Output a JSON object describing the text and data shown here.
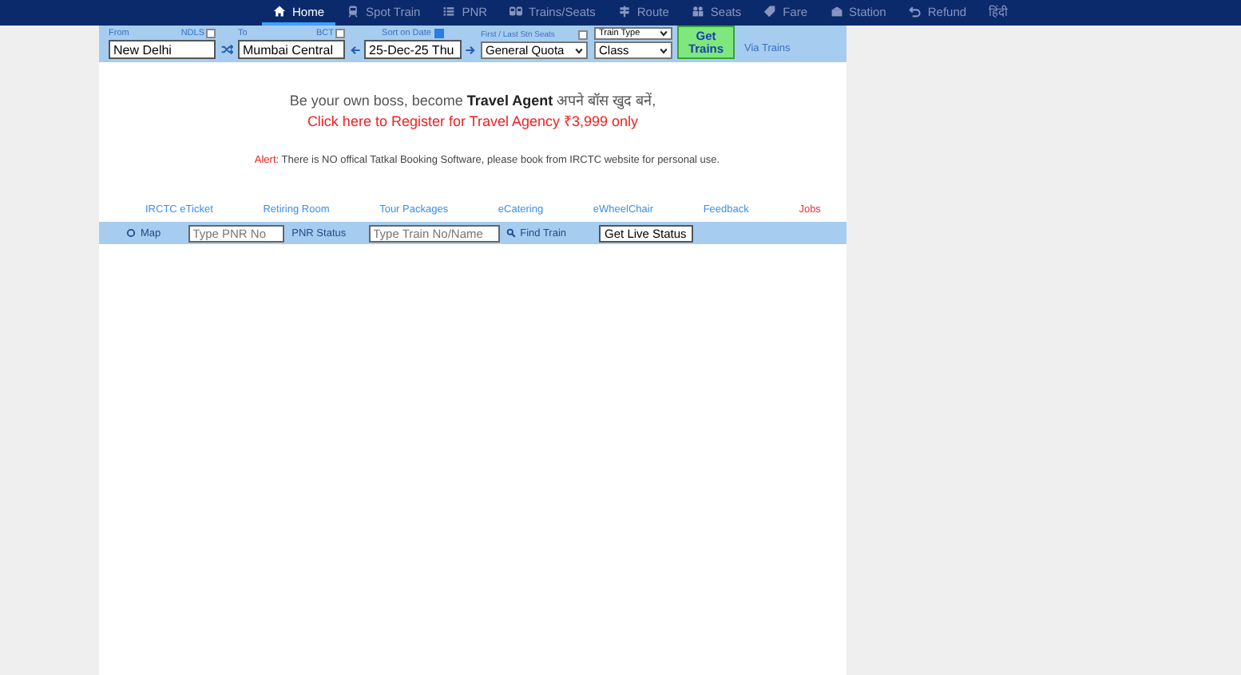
{
  "nav": [
    {
      "label": "Home",
      "selected": true
    },
    {
      "label": "Spot Train",
      "selected": false
    },
    {
      "label": "PNR",
      "selected": false
    },
    {
      "label": "Trains/Seats",
      "selected": false
    },
    {
      "label": "Route",
      "selected": false
    },
    {
      "label": "Seats",
      "selected": false
    },
    {
      "label": "Fare",
      "selected": false
    },
    {
      "label": "Station",
      "selected": false
    },
    {
      "label": "Refund",
      "selected": false
    },
    {
      "label": "हिंदी",
      "selected": false
    }
  ],
  "search": {
    "from": {
      "label": "From",
      "code": "NDLS",
      "checked": false,
      "value": "New Delhi"
    },
    "to": {
      "label": "To",
      "code": "BCT",
      "checked": false,
      "value": "Mumbai Central"
    },
    "sort_on_date": {
      "label": "Sort on Date",
      "checked": true
    },
    "date": "25-Dec-25 Thu",
    "first_last": {
      "label": "First / Last Stn Seats",
      "checked": false
    },
    "quota": "General Quota",
    "train_type": "Train Type",
    "class": "Class",
    "submit": "Get Trains",
    "via": "Via Trains"
  },
  "promo": {
    "line": "Be your own boss, become **Travel Agent** अपने बॉस खुद बनें,",
    "link": "Click here to Register for Travel Agency ₹3,999 only"
  },
  "alert": {
    "label": "Alert",
    "text": ": There is NO offical Tatkal Booking Software, please book from IRCTC website for personal use."
  },
  "links": [
    {
      "label": "IRCTC eTicket",
      "color": "#3b8ee8"
    },
    {
      "label": "Retiring Room",
      "color": "#3b8ee8"
    },
    {
      "label": "Tour Packages",
      "color": "#3b8ee8"
    },
    {
      "label": "eCatering",
      "color": "#3b8ee8"
    },
    {
      "label": "eWheelChair",
      "color": "#3b8ee8"
    },
    {
      "label": "Feedback",
      "color": "#3b8ee8"
    },
    {
      "label": "Jobs",
      "color": "#f03030"
    }
  ],
  "tools": {
    "map": "Map",
    "pnr_placeholder": "Type PNR No",
    "pnr_status": "PNR Status",
    "train_placeholder": "Type Train No/Name",
    "find_train": "Find Train",
    "live_status": "Get Live Status"
  }
}
